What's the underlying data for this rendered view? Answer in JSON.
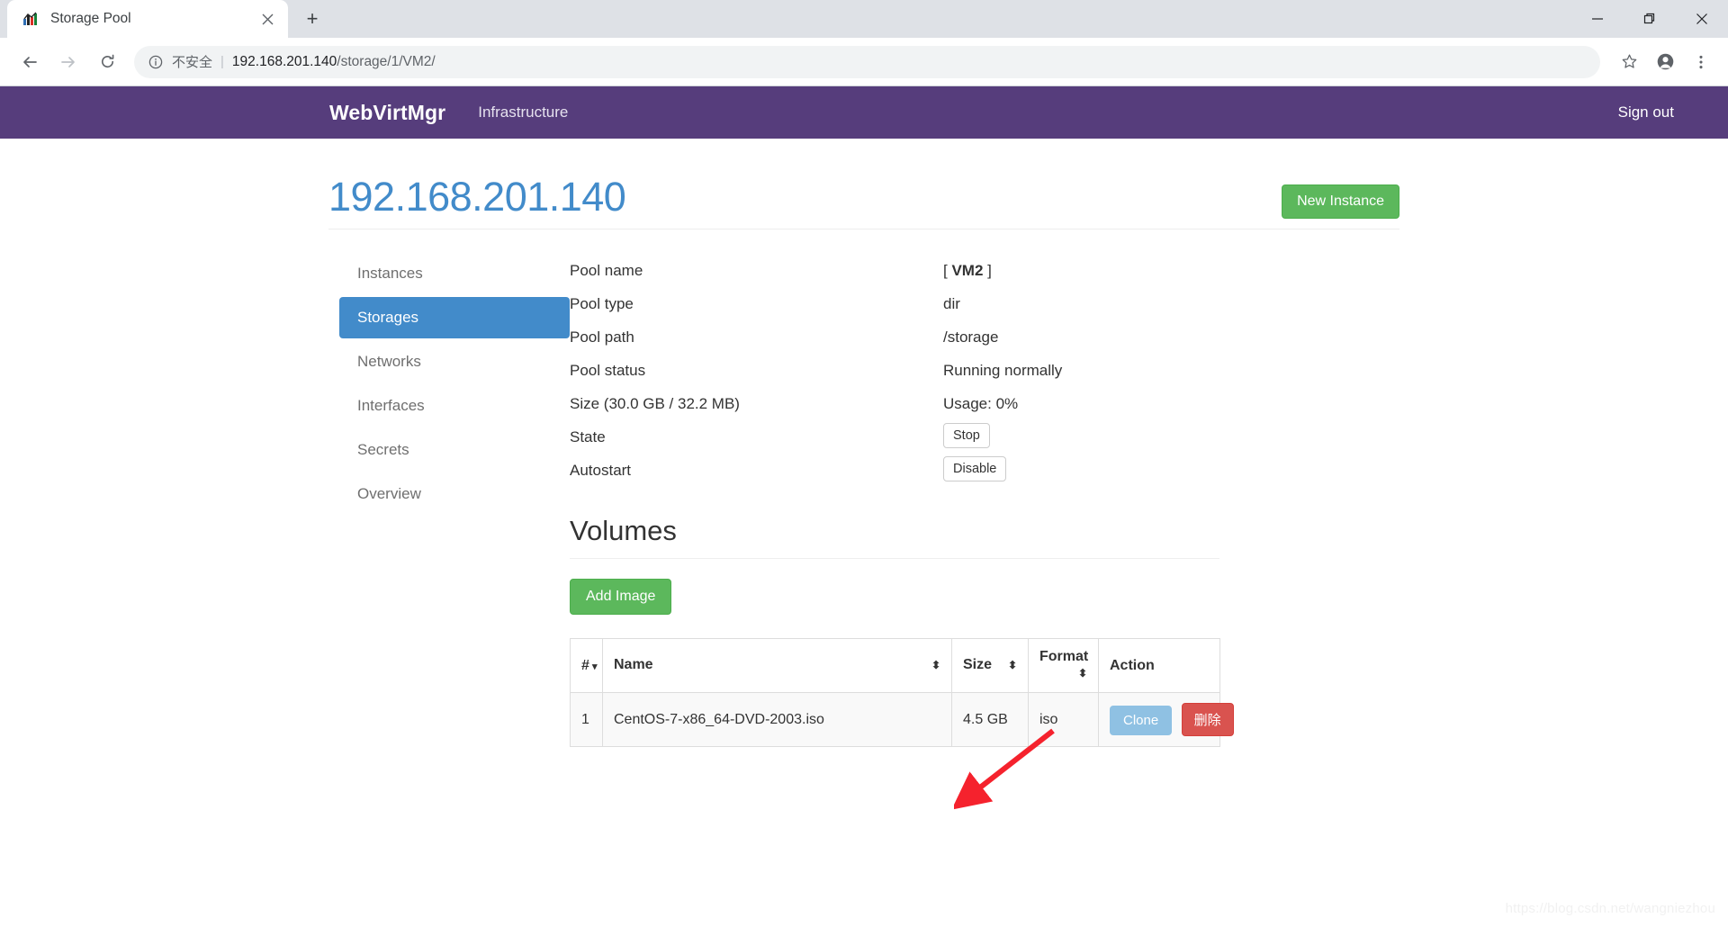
{
  "browser": {
    "tab": {
      "title": "Storage Pool",
      "favicon_icon": "app-favicon",
      "close_icon": "close-icon"
    },
    "new_tab_label": "+",
    "window_controls": {
      "minimize": "—",
      "maximize": "❐",
      "close": "✕"
    },
    "nav": {
      "back_icon": "back-arrow-icon",
      "forward_icon": "forward-arrow-icon",
      "reload_icon": "reload-icon"
    },
    "omnibox": {
      "info_icon": "info-circle-icon",
      "security_label": "不安全",
      "separator": "|",
      "url_host": "192.168.201.140",
      "url_path": "/storage/1/VM2/"
    },
    "toolbar_icons": {
      "bookmark": "star-icon",
      "profile": "account-avatar-icon",
      "menu": "three-dot-menu-icon"
    }
  },
  "navbar": {
    "brand": "WebVirtMgr",
    "links": [
      {
        "label": "Infrastructure"
      }
    ],
    "sign_out": "Sign out",
    "bg_color": "#563d7c"
  },
  "header": {
    "title": "192.168.201.140",
    "title_color": "#428bca",
    "new_instance_label": "New Instance",
    "new_instance_color": "#5cb85c"
  },
  "sidebar": {
    "items": [
      {
        "label": "Instances",
        "active": false
      },
      {
        "label": "Storages",
        "active": true
      },
      {
        "label": "Networks",
        "active": false
      },
      {
        "label": "Interfaces",
        "active": false
      },
      {
        "label": "Secrets",
        "active": false
      },
      {
        "label": "Overview",
        "active": false
      }
    ],
    "active_color": "#428bca"
  },
  "pool": {
    "rows": [
      {
        "label": "Pool name",
        "value": "VM2",
        "bracketed": true
      },
      {
        "label": "Pool type",
        "value": "dir"
      },
      {
        "label": "Pool path",
        "value": "/storage"
      },
      {
        "label": "Pool status",
        "value": "Running normally"
      },
      {
        "label": "Size (30.0 GB / 32.2 MB)",
        "value": "Usage: 0%"
      }
    ],
    "state_label": "State",
    "state_button": "Stop",
    "autostart_label": "Autostart",
    "autostart_button": "Disable"
  },
  "volumes": {
    "heading": "Volumes",
    "add_image_label": "Add Image",
    "columns": [
      {
        "label": "#",
        "sort": "caret-down"
      },
      {
        "label": "Name",
        "sort": "updown"
      },
      {
        "label": "Size",
        "sort": "updown"
      },
      {
        "label": "Format",
        "sort": "updown"
      },
      {
        "label": "Action",
        "sort": ""
      }
    ],
    "rows": [
      {
        "index": "1",
        "name": "CentOS-7-x86_64-DVD-2003.iso",
        "size": "4.5 GB",
        "format": "iso",
        "clone_label": "Clone",
        "delete_label": "删除"
      }
    ],
    "clone_color": "#8fc1e3",
    "delete_color": "#d9534f"
  },
  "annotation": {
    "arrow_color": "#f5222d"
  },
  "watermark": "https://blog.csdn.net/wangniezhou"
}
